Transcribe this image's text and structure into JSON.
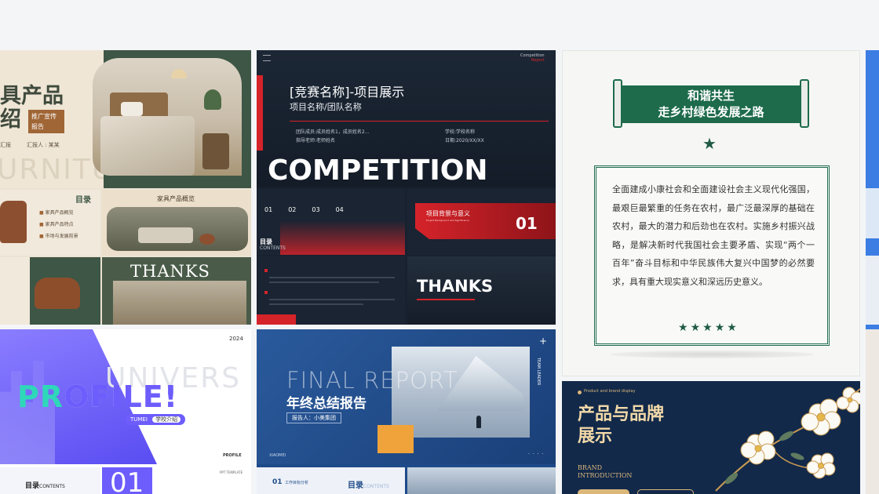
{
  "colors": {
    "page_bg": "#f4f5f7",
    "furniture_bg": "#ece3d3",
    "furniture_green": "#3d5646",
    "furniture_brown": "#a06636",
    "competition_bg": "#172130",
    "competition_red": "#d5232a",
    "harmony_green": "#1e6b4c",
    "profile_purple": "#6d5dfc",
    "profile_teal": "#2fd7b9",
    "report_blue": "#1e4a89",
    "report_orange": "#f0a33a",
    "brand_navy": "#12294a",
    "brand_gold": "#dcb77a"
  },
  "cards": {
    "furniture": {
      "title_line1": "具产品",
      "title_line2": "绍",
      "tag_line1": "推广宣传",
      "tag_line2": "报告",
      "info_a": "汇报",
      "info_b": "汇报人 : 某某",
      "bg_word": "URNITU",
      "toc_title": "目录",
      "toc_items": [
        "家具产品概览",
        "家具产品特点",
        "市场与发展前景"
      ],
      "overview_title": "家具产品概览",
      "thanks": "THANKS",
      "icons": [
        "chair-icon",
        "sofa-icon",
        "bed-icon",
        "lamp-icon",
        "plant-icon"
      ]
    },
    "competition": {
      "corner_label_line1": "Competition",
      "corner_label_line2": "Report",
      "title": "[竞赛名称]-项目展示",
      "subtitle": "项目名称/团队名称",
      "info_left_1": "团队成员:成员姓名1，成员姓名2...",
      "info_left_2": "指导老师:老师姓名",
      "info_right_1": "学校:学校名称",
      "info_right_2": "日期:2020/XX/XX",
      "big_word": "COMPETITION",
      "toc_nums": [
        "01",
        "02",
        "03",
        "04"
      ],
      "toc_label": "目录",
      "toc_sub": "CONTENTS",
      "section_title": "项目背景与意义",
      "section_sub": "Project Background and Significance",
      "section_num": "01",
      "thanks": "THANKS"
    },
    "harmony": {
      "banner_line1": "和谐共生",
      "banner_line2": "走乡村绿色发展之路",
      "paragraph": "全面建成小康社会和全面建设社会主义现代化强国，最艰巨最繁重的任务在农村，最广泛最深厚的基础在农村，最大的潜力和后劲也在农村。实施乡村振兴战略，是解决新时代我国社会主要矛盾、实现“两个一百年”奋斗目标和中华民族伟大复兴中国梦的必然要求，具有重大现实意义和深远历史意义。",
      "stars_count": 5
    },
    "profile": {
      "year": "2024",
      "bg_word": "UNIVERS",
      "title_a": "PR",
      "title_b": "OFILE!",
      "tag": "TUMEI",
      "tag_text": "学校介绍",
      "footer_word": "PROFILE",
      "toc_label": "目录",
      "toc_sub": "CONTENTS",
      "toc_num": "01",
      "toc_small": "PPT TEMPLATE"
    },
    "report": {
      "title_en": "FINAL REPORT",
      "title_cn": "年终总结报告",
      "reporter": "报告人：小美集团",
      "side_label": "TEAM LEADER",
      "brand": "XIAOMEI",
      "toc_num": "01",
      "toc_item": "工作目标分析",
      "toc_label": "目录",
      "toc_sub": "CONTENTS"
    },
    "brand": {
      "kicker": "Product and brand display",
      "title_line1": "产品与品牌",
      "title_line2": "展示",
      "en_line1": "BRAND",
      "en_line2": "INTRODUCTION"
    }
  }
}
